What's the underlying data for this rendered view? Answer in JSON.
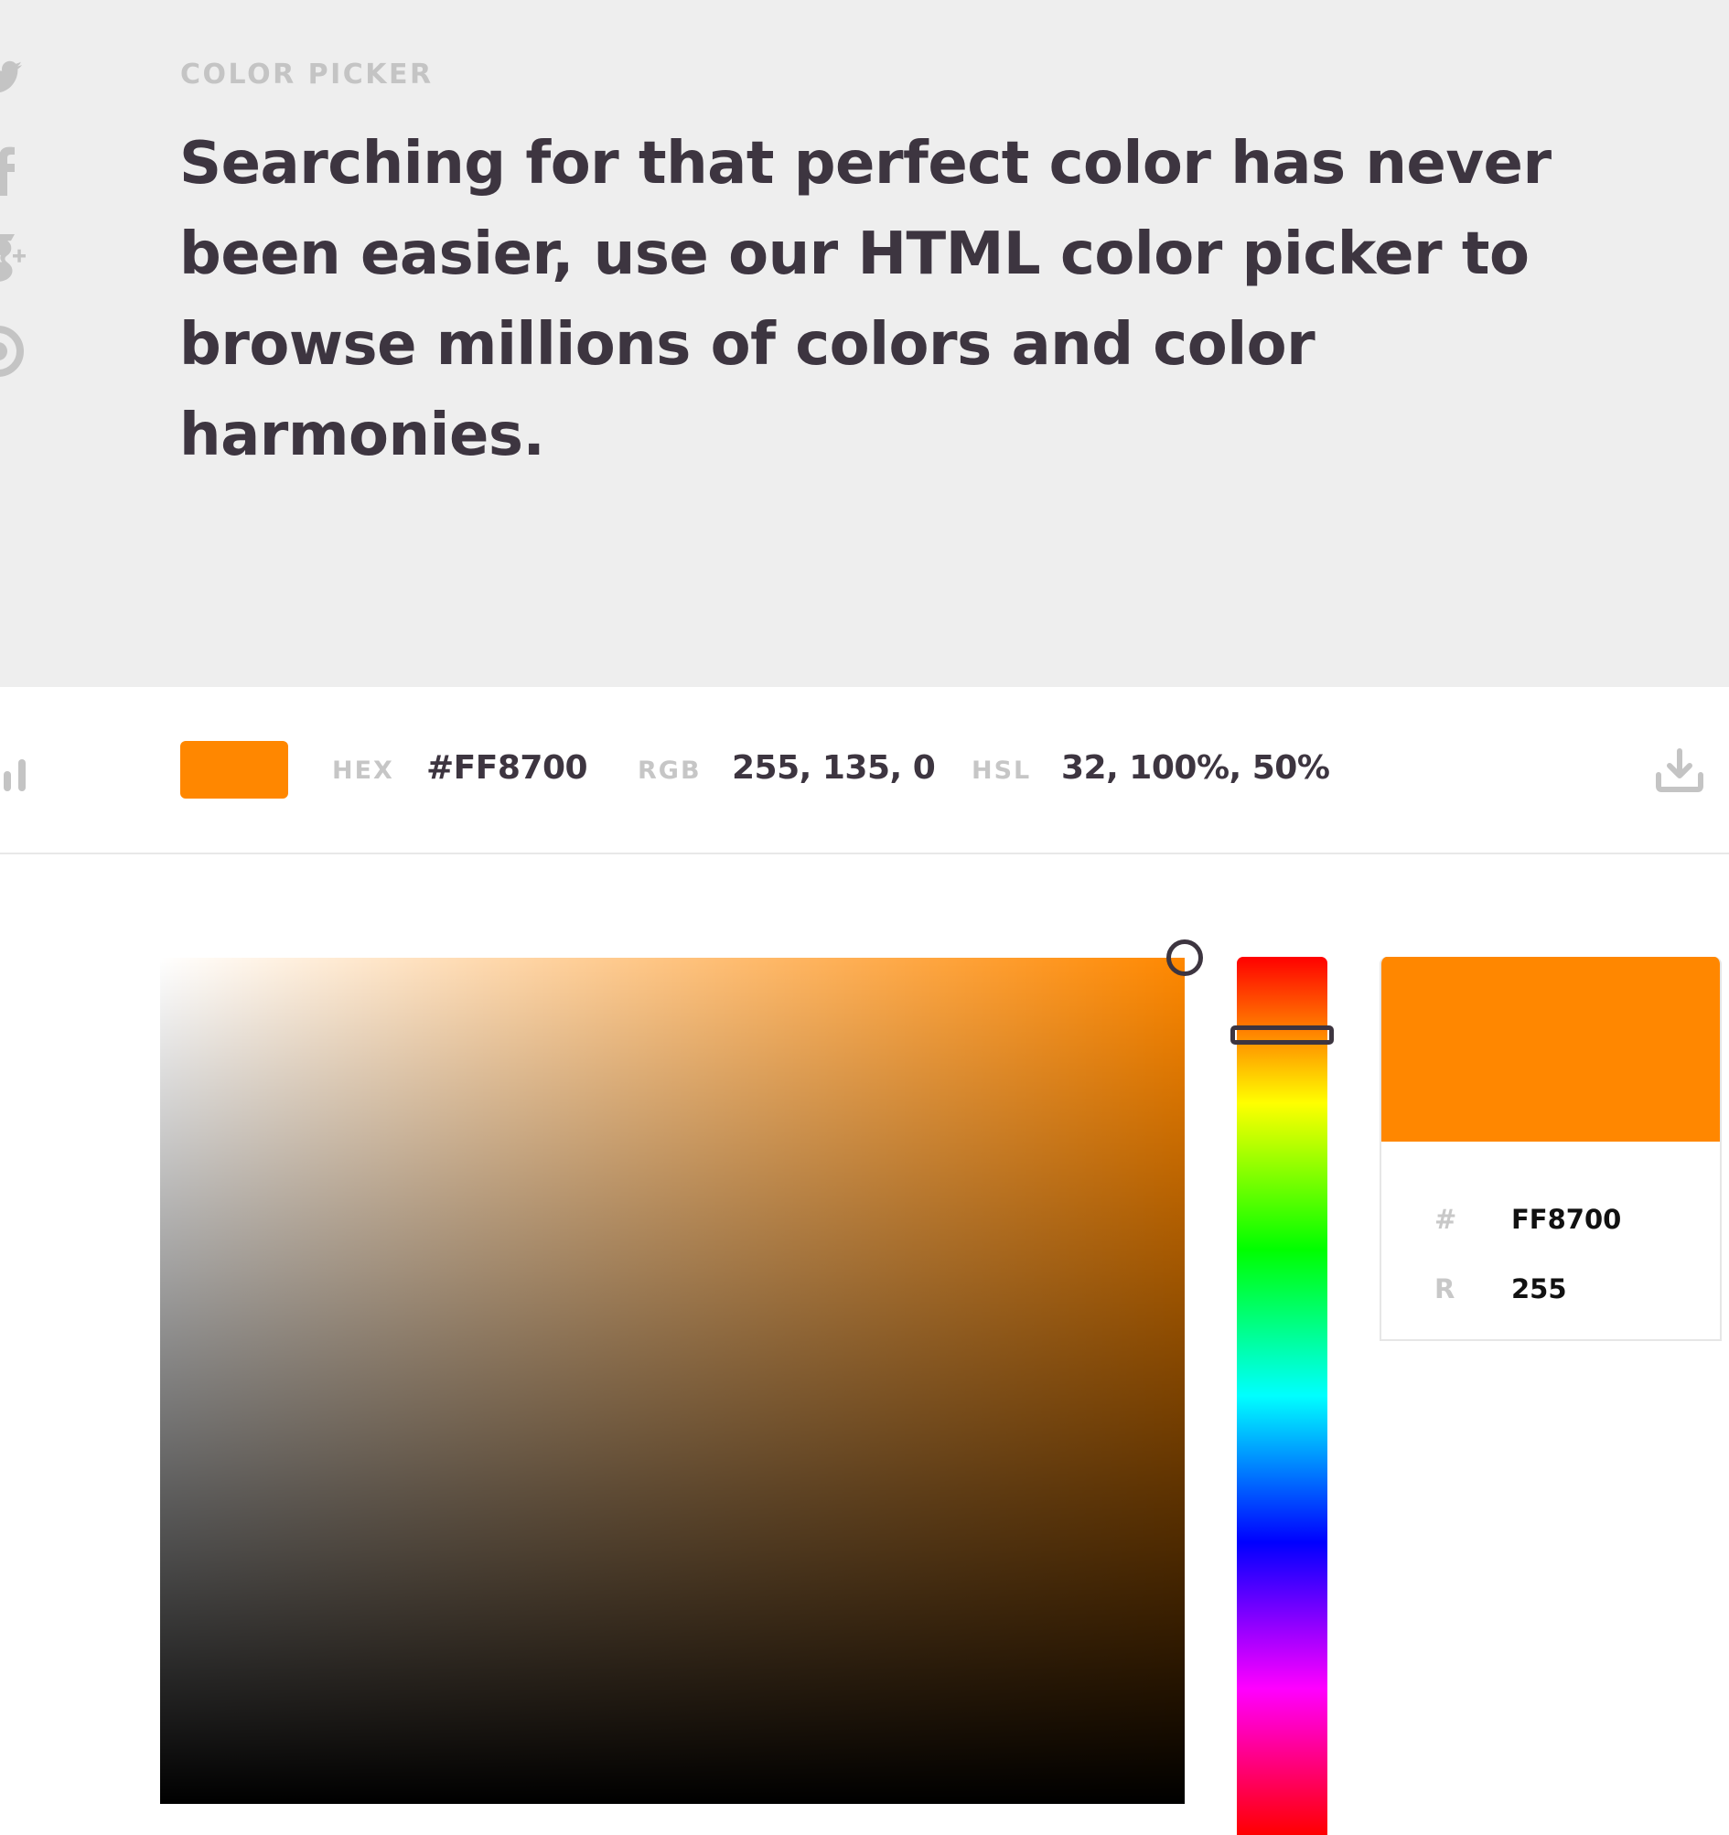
{
  "hero": {
    "eyebrow": "COLOR PICKER",
    "headline": "Searching for that perfect color has never been easier, use our HTML color picker to browse millions of colors and color harmonies."
  },
  "social": [
    {
      "icon": "twitter-icon"
    },
    {
      "icon": "facebook-icon"
    },
    {
      "icon": "google-plus-icon"
    },
    {
      "icon": "pinterest-icon"
    }
  ],
  "infobar": {
    "swatch_color": "#FF8700",
    "hex_label": "HEX",
    "hex_value": "#FF8700",
    "rgb_label": "RGB",
    "rgb_value": "255, 135, 0",
    "hsl_label": "HSL",
    "hsl_value": "32, 100%, 50%",
    "download_icon": "download-icon",
    "side_icon": "bar-chart-icon"
  },
  "picker": {
    "hue_degrees": 32,
    "saturation_percent": 100,
    "value_percent": 100,
    "current_color": "#FF8700"
  },
  "preview": {
    "color": "#FF8700",
    "rows": [
      {
        "label": "#",
        "value": "FF8700"
      },
      {
        "label": "R",
        "value": "255"
      }
    ]
  },
  "colors": {
    "accent": "#FF8700",
    "text_dark": "#3D3540",
    "text_muted": "#C4C4C4",
    "hero_bg": "#EEEEEE"
  }
}
